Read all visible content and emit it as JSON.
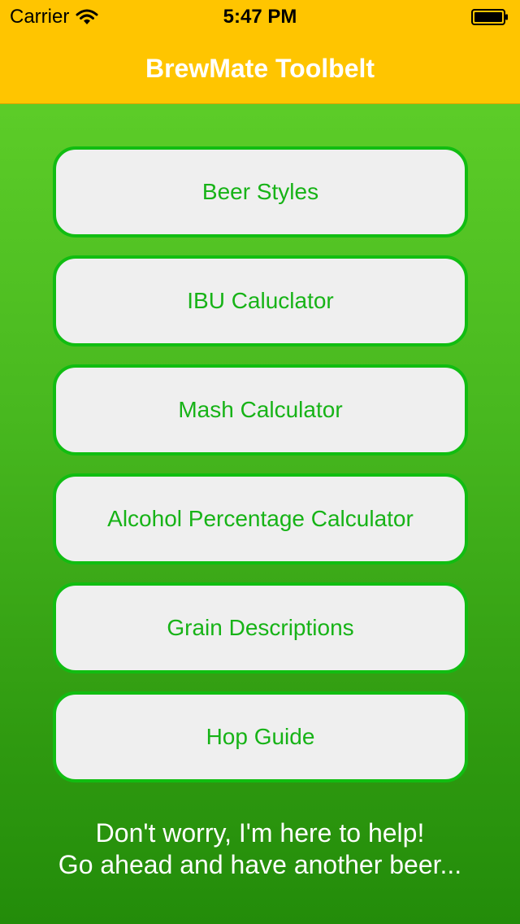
{
  "status_bar": {
    "carrier": "Carrier",
    "time": "5:47 PM"
  },
  "nav": {
    "title": "BrewMate Toolbelt"
  },
  "menu": [
    {
      "label": "Beer Styles"
    },
    {
      "label": "IBU Caluclator"
    },
    {
      "label": "Mash Calculator"
    },
    {
      "label": "Alcohol Percentage Calculator"
    },
    {
      "label": "Grain Descriptions"
    },
    {
      "label": "Hop Guide"
    }
  ],
  "footer": {
    "line1": "Don't worry, I'm here to help!",
    "line2": "Go ahead and have another beer..."
  },
  "colors": {
    "nav_bar": "#ffc500",
    "background_top": "#63d32b",
    "background_bottom": "#238c0a",
    "button_border": "#11bd11",
    "button_text": "#17b317",
    "button_fill": "#efefef"
  },
  "icons": [
    "wifi-icon",
    "battery-icon"
  ]
}
